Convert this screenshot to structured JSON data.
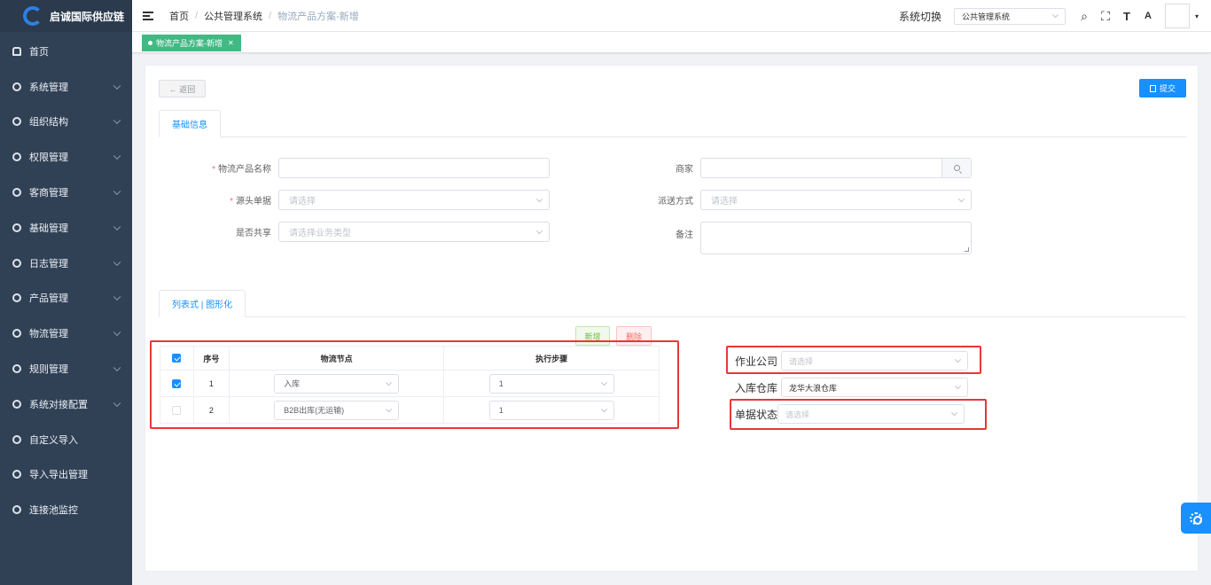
{
  "sidebar": {
    "brand": "启诚国际供应链",
    "items": [
      {
        "label": "首页",
        "icon": "dashboard-icon",
        "expandable": false
      },
      {
        "label": "系统管理",
        "icon": "menu-icon",
        "expandable": true
      },
      {
        "label": "组织结构",
        "icon": "menu-icon",
        "expandable": true
      },
      {
        "label": "权限管理",
        "icon": "menu-icon",
        "expandable": true
      },
      {
        "label": "客商管理",
        "icon": "menu-icon",
        "expandable": true
      },
      {
        "label": "基础管理",
        "icon": "menu-icon",
        "expandable": true
      },
      {
        "label": "日志管理",
        "icon": "menu-icon",
        "expandable": true
      },
      {
        "label": "产品管理",
        "icon": "menu-icon",
        "expandable": true
      },
      {
        "label": "物流管理",
        "icon": "menu-icon",
        "expandable": true
      },
      {
        "label": "规则管理",
        "icon": "menu-icon",
        "expandable": true
      },
      {
        "label": "系统对接配置",
        "icon": "menu-icon",
        "expandable": true
      },
      {
        "label": "自定义导入",
        "icon": "menu-icon",
        "expandable": false
      },
      {
        "label": "导入导出管理",
        "icon": "menu-icon",
        "expandable": false
      },
      {
        "label": "连接池监控",
        "icon": "menu-icon",
        "expandable": false
      }
    ]
  },
  "header": {
    "breadcrumb": [
      "首页",
      "公共管理系统",
      "物流产品方案-新增"
    ],
    "switch_label": "系统切换",
    "switch_value": "公共管理系统"
  },
  "tags": {
    "active": "物流产品方案-新增"
  },
  "actions": {
    "back": "← 返回",
    "submit": "提交"
  },
  "tabs": {
    "basic": "基础信息",
    "view": "列表式 | 图形化"
  },
  "form": {
    "product_name": {
      "label": "物流产品名称",
      "required": true,
      "value": ""
    },
    "source_doc": {
      "label": "源头单据",
      "required": true,
      "placeholder": "请选择"
    },
    "shared": {
      "label": "是否共享",
      "placeholder": "请选择业务类型"
    },
    "merchant": {
      "label": "商家",
      "value": ""
    },
    "delivery": {
      "label": "派送方式",
      "placeholder": "请选择"
    },
    "remark": {
      "label": "备注",
      "value": ""
    }
  },
  "table": {
    "add": "新增",
    "delete": "删除",
    "headers": [
      "序号",
      "物流节点",
      "执行步骤"
    ],
    "rows": [
      {
        "checked": true,
        "index": "1",
        "node": "入库",
        "step": "1"
      },
      {
        "checked": false,
        "index": "2",
        "node": "B2B出库(无运输)",
        "step": "1"
      }
    ]
  },
  "node_panel": {
    "company": {
      "label": "作业公司",
      "placeholder": "请选择"
    },
    "warehouse": {
      "label": "入库仓库",
      "value": "龙华大浪仓库"
    },
    "status": {
      "label": "单据状态",
      "placeholder": "请选择"
    }
  },
  "colors": {
    "primary": "#1890ff",
    "sidebar": "#304156",
    "highlight": "#e53935",
    "tag": "#42b983"
  }
}
